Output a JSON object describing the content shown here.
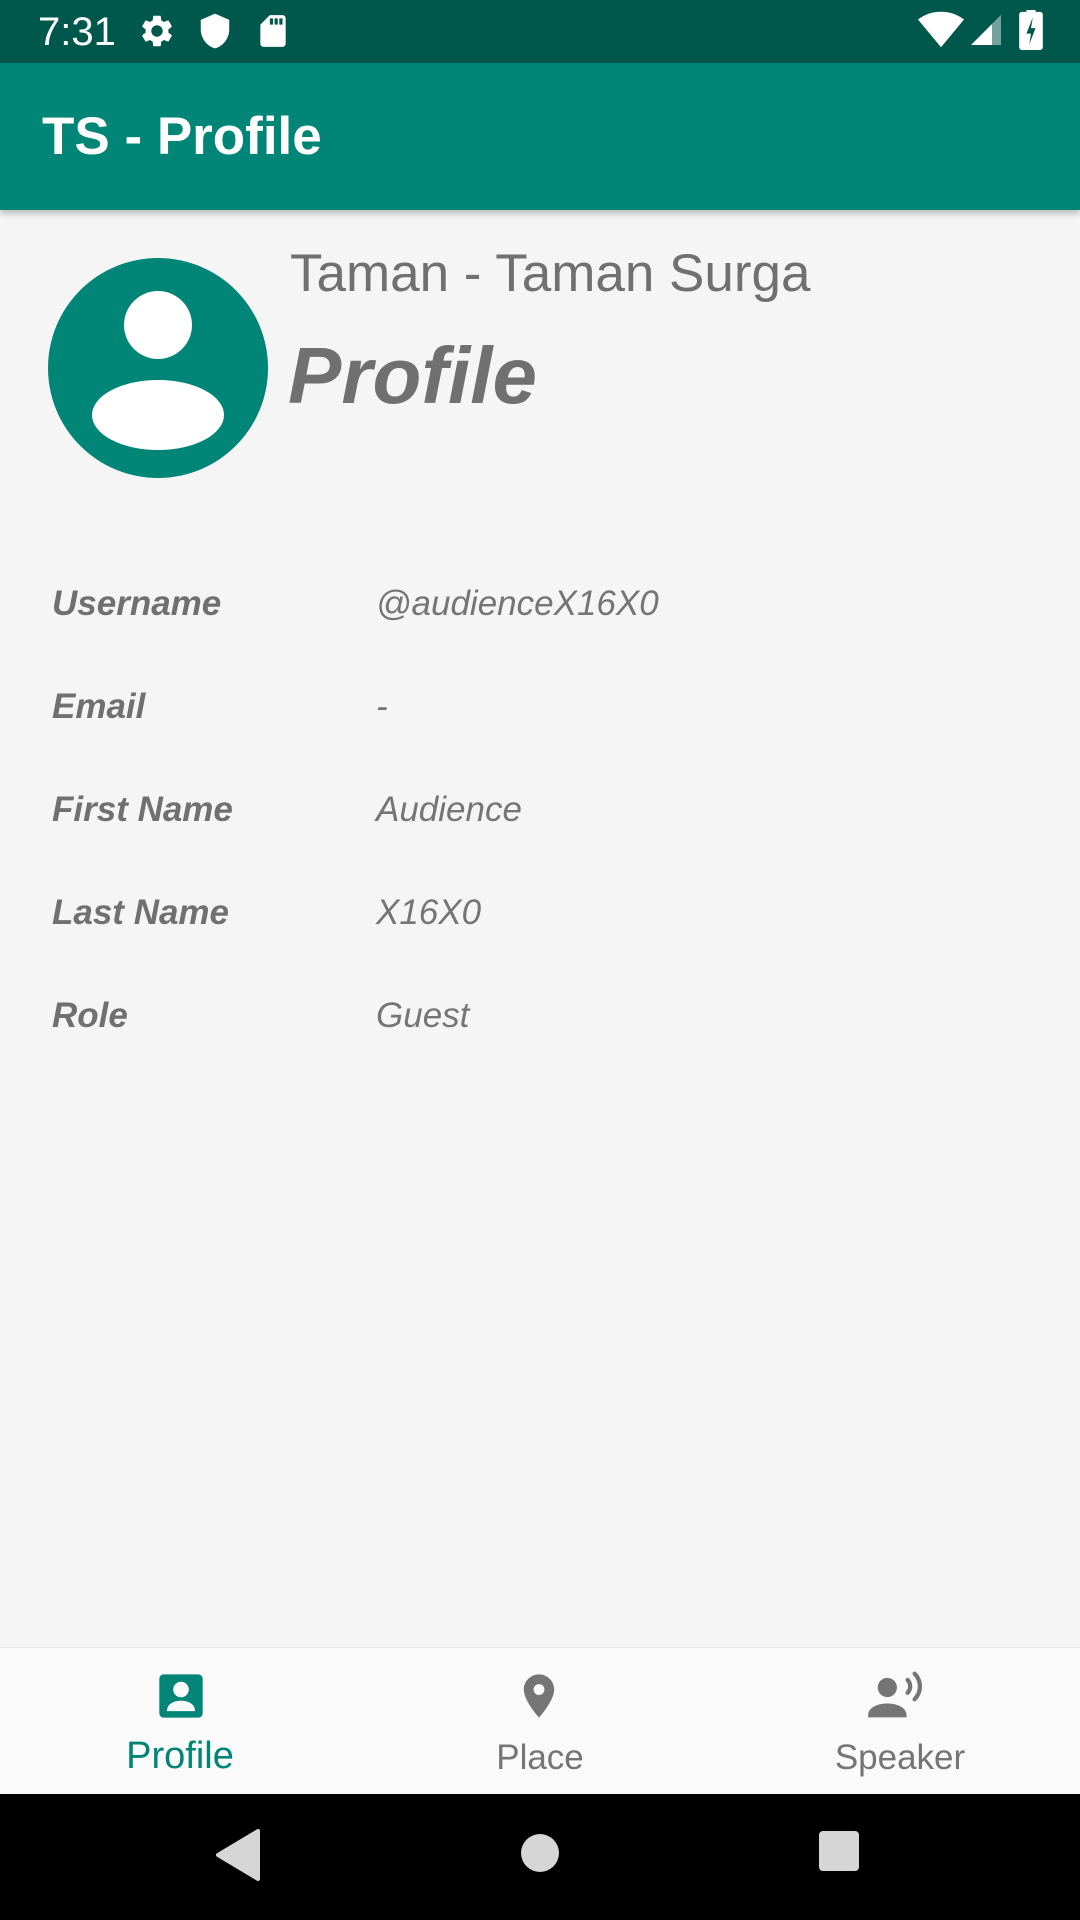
{
  "status_bar": {
    "time": "7:31",
    "icons": [
      "gear-icon",
      "shield-icon",
      "sd-card-icon",
      "wifi-icon",
      "signal-icon",
      "battery-charging-icon"
    ]
  },
  "app_bar": {
    "title": "TS - Profile"
  },
  "header": {
    "org_name": "Taman - Taman Surga",
    "heading": "Profile",
    "avatar_icon": "account-circle-icon"
  },
  "details": [
    {
      "label": "Username",
      "value": "@audienceX16X0"
    },
    {
      "label": "Email",
      "value": "-"
    },
    {
      "label": "First Name",
      "value": "Audience"
    },
    {
      "label": "Last Name",
      "value": "X16X0"
    },
    {
      "label": "Role",
      "value": "Guest"
    }
  ],
  "bottom_nav": {
    "items": [
      {
        "label": "Profile",
        "icon": "profile-badge-icon",
        "active": true
      },
      {
        "label": "Place",
        "icon": "location-pin-icon",
        "active": false
      },
      {
        "label": "Speaker",
        "icon": "speaker-person-icon",
        "active": false
      }
    ]
  },
  "system_nav": {
    "buttons": [
      "back-icon",
      "home-icon",
      "recents-icon"
    ]
  },
  "colors": {
    "primary": "#008577",
    "primary_dark": "#00574b",
    "text_secondary": "#707070",
    "background": "#f5f5f5"
  }
}
